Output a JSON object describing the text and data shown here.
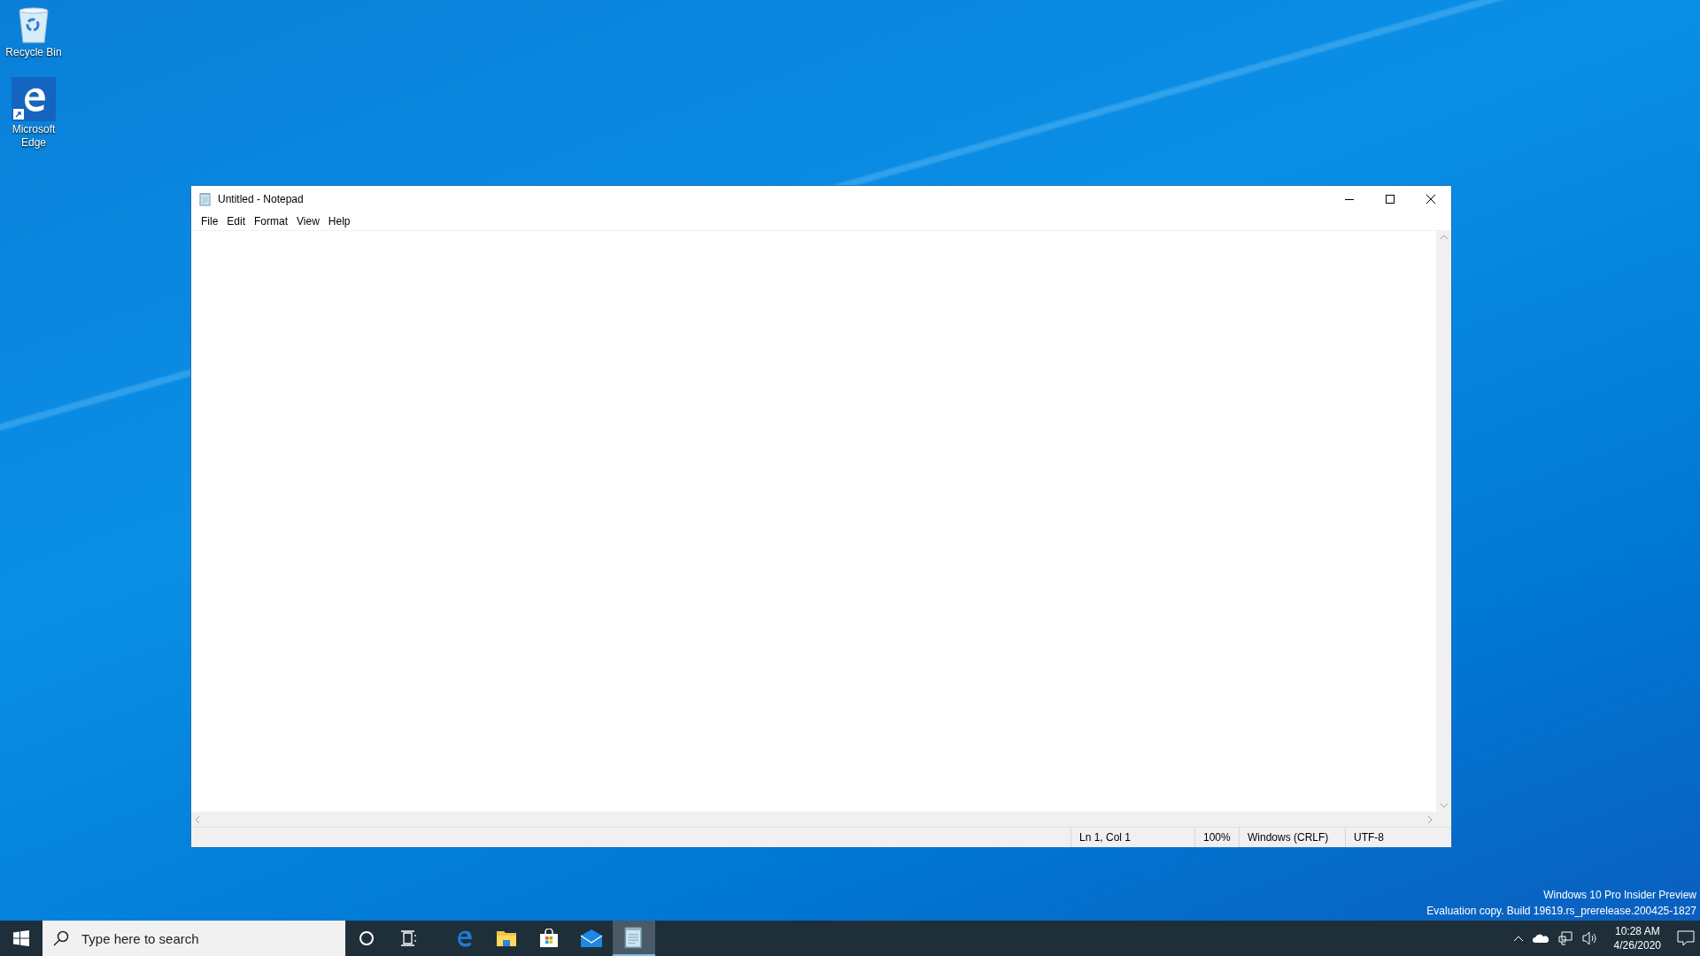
{
  "desktop": {
    "icons": [
      {
        "label": "Recycle Bin",
        "kind": "recycle"
      },
      {
        "label": "Microsoft Edge",
        "kind": "edge"
      }
    ]
  },
  "window": {
    "title": "Untitled - Notepad",
    "menu": [
      "File",
      "Edit",
      "Format",
      "View",
      "Help"
    ],
    "status_bar": [
      "Ln 1, Col 1",
      "100%",
      "Windows (CRLF)",
      "UTF-8"
    ]
  },
  "build_info": [
    "Windows 10 Pro Insider Preview",
    "Evaluation copy. Build 19619.rs_prerelease.200425-1827"
  ],
  "taskbar": {
    "search": {
      "placeholder": "Type here to search"
    },
    "apps": [
      {
        "kind": "edge",
        "selected": false
      },
      {
        "kind": "explorer",
        "selected": false
      },
      {
        "kind": "store",
        "selected": false
      },
      {
        "kind": "mail",
        "selected": false
      },
      {
        "kind": "notepad",
        "selected": true
      }
    ],
    "clock": {
      "time": "10:28 AM",
      "date": "4/26/2020"
    }
  }
}
